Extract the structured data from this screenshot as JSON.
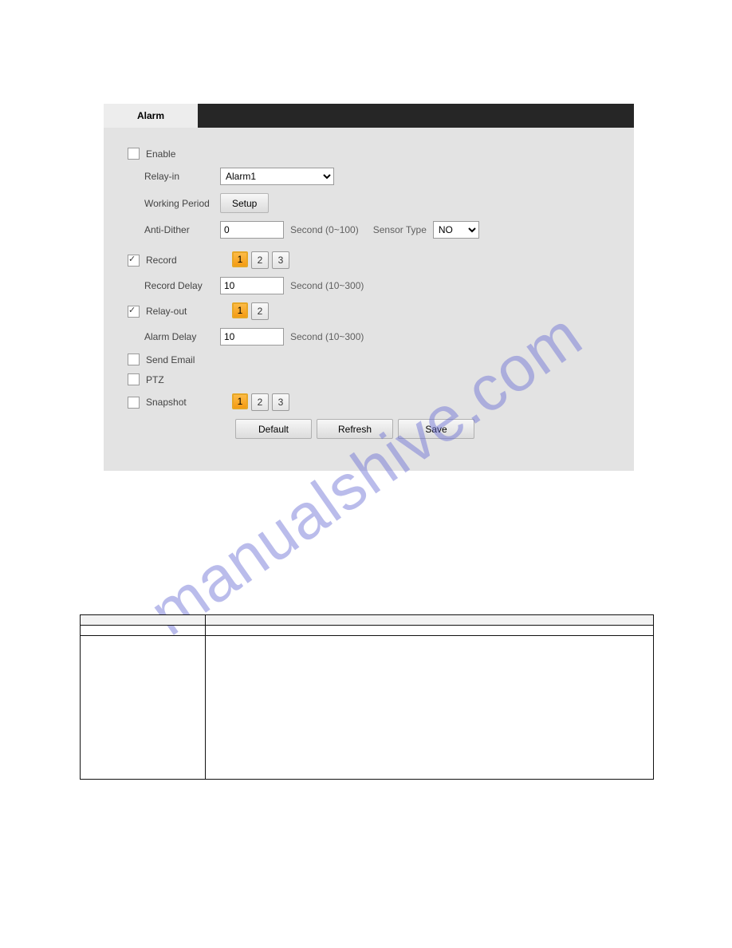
{
  "tab": {
    "label": "Alarm"
  },
  "fields": {
    "enable_label": "Enable",
    "relay_in_label": "Relay-in",
    "relay_in_value": "Alarm1",
    "working_period_label": "Working Period",
    "setup_btn": "Setup",
    "anti_dither_label": "Anti-Dither",
    "anti_dither_value": "0",
    "anti_dither_unit": "Second (0~100)",
    "sensor_type_label": "Sensor Type",
    "sensor_type_value": "NO",
    "record_label": "Record",
    "record_delay_label": "Record Delay",
    "record_delay_value": "10",
    "record_delay_unit": "Second (10~300)",
    "relay_out_label": "Relay-out",
    "alarm_delay_label": "Alarm Delay",
    "alarm_delay_value": "10",
    "alarm_delay_unit": "Second (10~300)",
    "send_email_label": "Send Email",
    "ptz_label": "PTZ",
    "snapshot_label": "Snapshot"
  },
  "channels": {
    "record": [
      "1",
      "2",
      "3"
    ],
    "relay_out": [
      "1",
      "2"
    ],
    "snapshot": [
      "1",
      "2",
      "3"
    ]
  },
  "buttons": {
    "default": "Default",
    "refresh": "Refresh",
    "save": "Save"
  },
  "watermark": "manualshive.com",
  "param_table": {
    "headers": [
      "",
      ""
    ],
    "rows": [
      [
        "",
        ""
      ],
      [
        "",
        ""
      ]
    ]
  }
}
